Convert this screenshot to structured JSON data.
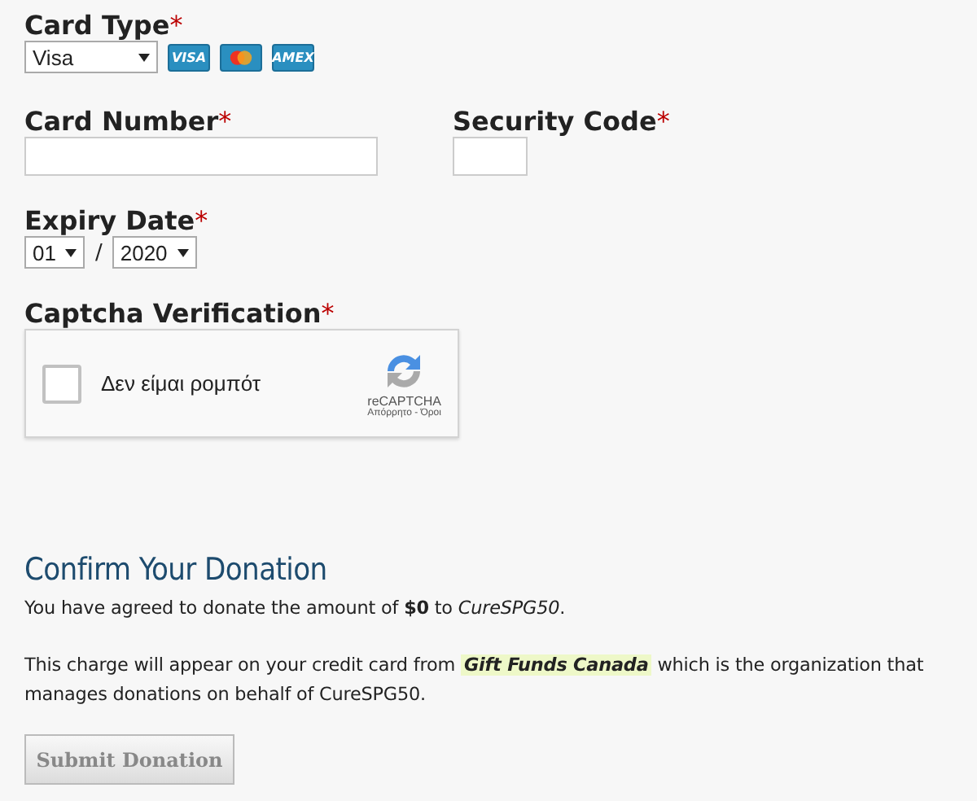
{
  "required_mark": "*",
  "card_type": {
    "label": "Card Type",
    "required": true,
    "value": "Visa",
    "logos": [
      {
        "kind": "visa",
        "text": "VISA"
      },
      {
        "kind": "mastercard"
      },
      {
        "kind": "amex",
        "text": "AMEX"
      }
    ]
  },
  "card_number": {
    "label": "Card Number",
    "required": true
  },
  "security_code": {
    "label": "Security Code",
    "required": true
  },
  "expiry": {
    "label": "Expiry Date",
    "required": true,
    "month": "01",
    "separator": "/",
    "year": "2020"
  },
  "captcha": {
    "label": "Captcha Verification",
    "required": true,
    "checked": false,
    "text": "Δεν είμαι ρομπότ",
    "brand": "reCAPTCHA",
    "links": "Απόρρητο - Όροι"
  },
  "confirm": {
    "title": "Confirm Your Donation",
    "agreement": "You have agreed to donate the amount of **$0** to *CureSPG50*.",
    "charge_before": "This charge will appear on your credit card from ",
    "charge_highlight": "Gift Funds Canada",
    "charge_after": " which is the organization that manages donations on behalf of CureSPG50.",
    "button": "Submit Donation"
  }
}
